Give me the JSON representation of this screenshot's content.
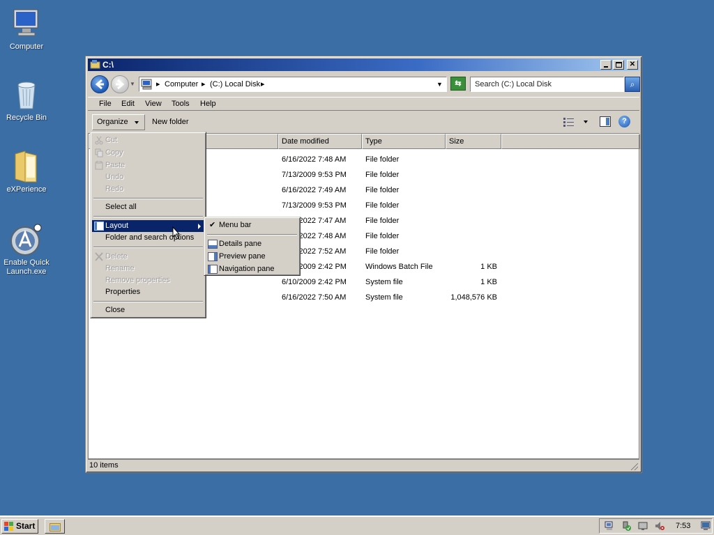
{
  "desktop": {
    "icons": [
      {
        "label": "Computer"
      },
      {
        "label": "Recycle Bin"
      },
      {
        "label": "eXPerience"
      },
      {
        "label": "Enable Quick Launch.exe"
      }
    ]
  },
  "window": {
    "title": "C:\\",
    "address": {
      "crumb1": "Computer",
      "crumb2": "(C:) Local Disk"
    },
    "search_placeholder": "Search (C:) Local Disk",
    "menubar": [
      "File",
      "Edit",
      "View",
      "Tools",
      "Help"
    ],
    "toolbar": {
      "organize": "Organize",
      "new_folder": "New folder"
    },
    "columns": {
      "date": "Date modified",
      "type": "Type",
      "size": "Size"
    },
    "rows": [
      {
        "date": "6/16/2022 7:48 AM",
        "type": "File folder",
        "size": ""
      },
      {
        "date": "7/13/2009 9:53 PM",
        "type": "File folder",
        "size": ""
      },
      {
        "date": "6/16/2022 7:49 AM",
        "type": "File folder",
        "size": ""
      },
      {
        "date": "7/13/2009 9:53 PM",
        "type": "File folder",
        "size": ""
      },
      {
        "date": "6/16/2022 7:47 AM",
        "type": "File folder",
        "size": ""
      },
      {
        "date": "6/16/2022 7:48 AM",
        "type": "File folder",
        "size": ""
      },
      {
        "date": "6/16/2022 7:52 AM",
        "type": "File folder",
        "size": ""
      },
      {
        "date": "6/10/2009 2:42 PM",
        "type": "Windows Batch File",
        "size": "1 KB"
      },
      {
        "date": "6/10/2009 2:42 PM",
        "type": "System file",
        "size": "1 KB"
      },
      {
        "date": "6/16/2022 7:50 AM",
        "type": "System file",
        "size": "1,048,576 KB"
      }
    ],
    "status": "10 items"
  },
  "organize_menu": {
    "cut": "Cut",
    "copy": "Copy",
    "paste": "Paste",
    "undo": "Undo",
    "redo": "Redo",
    "select_all": "Select all",
    "layout": "Layout",
    "folder_options": "Folder and search options",
    "delete": "Delete",
    "rename": "Rename",
    "remove_properties": "Remove properties",
    "properties": "Properties",
    "close": "Close"
  },
  "layout_submenu": {
    "menu_bar": "Menu bar",
    "details_pane": "Details pane",
    "preview_pane": "Preview pane",
    "navigation_pane": "Navigation pane"
  },
  "taskbar": {
    "start": "Start",
    "clock": "7:53"
  }
}
